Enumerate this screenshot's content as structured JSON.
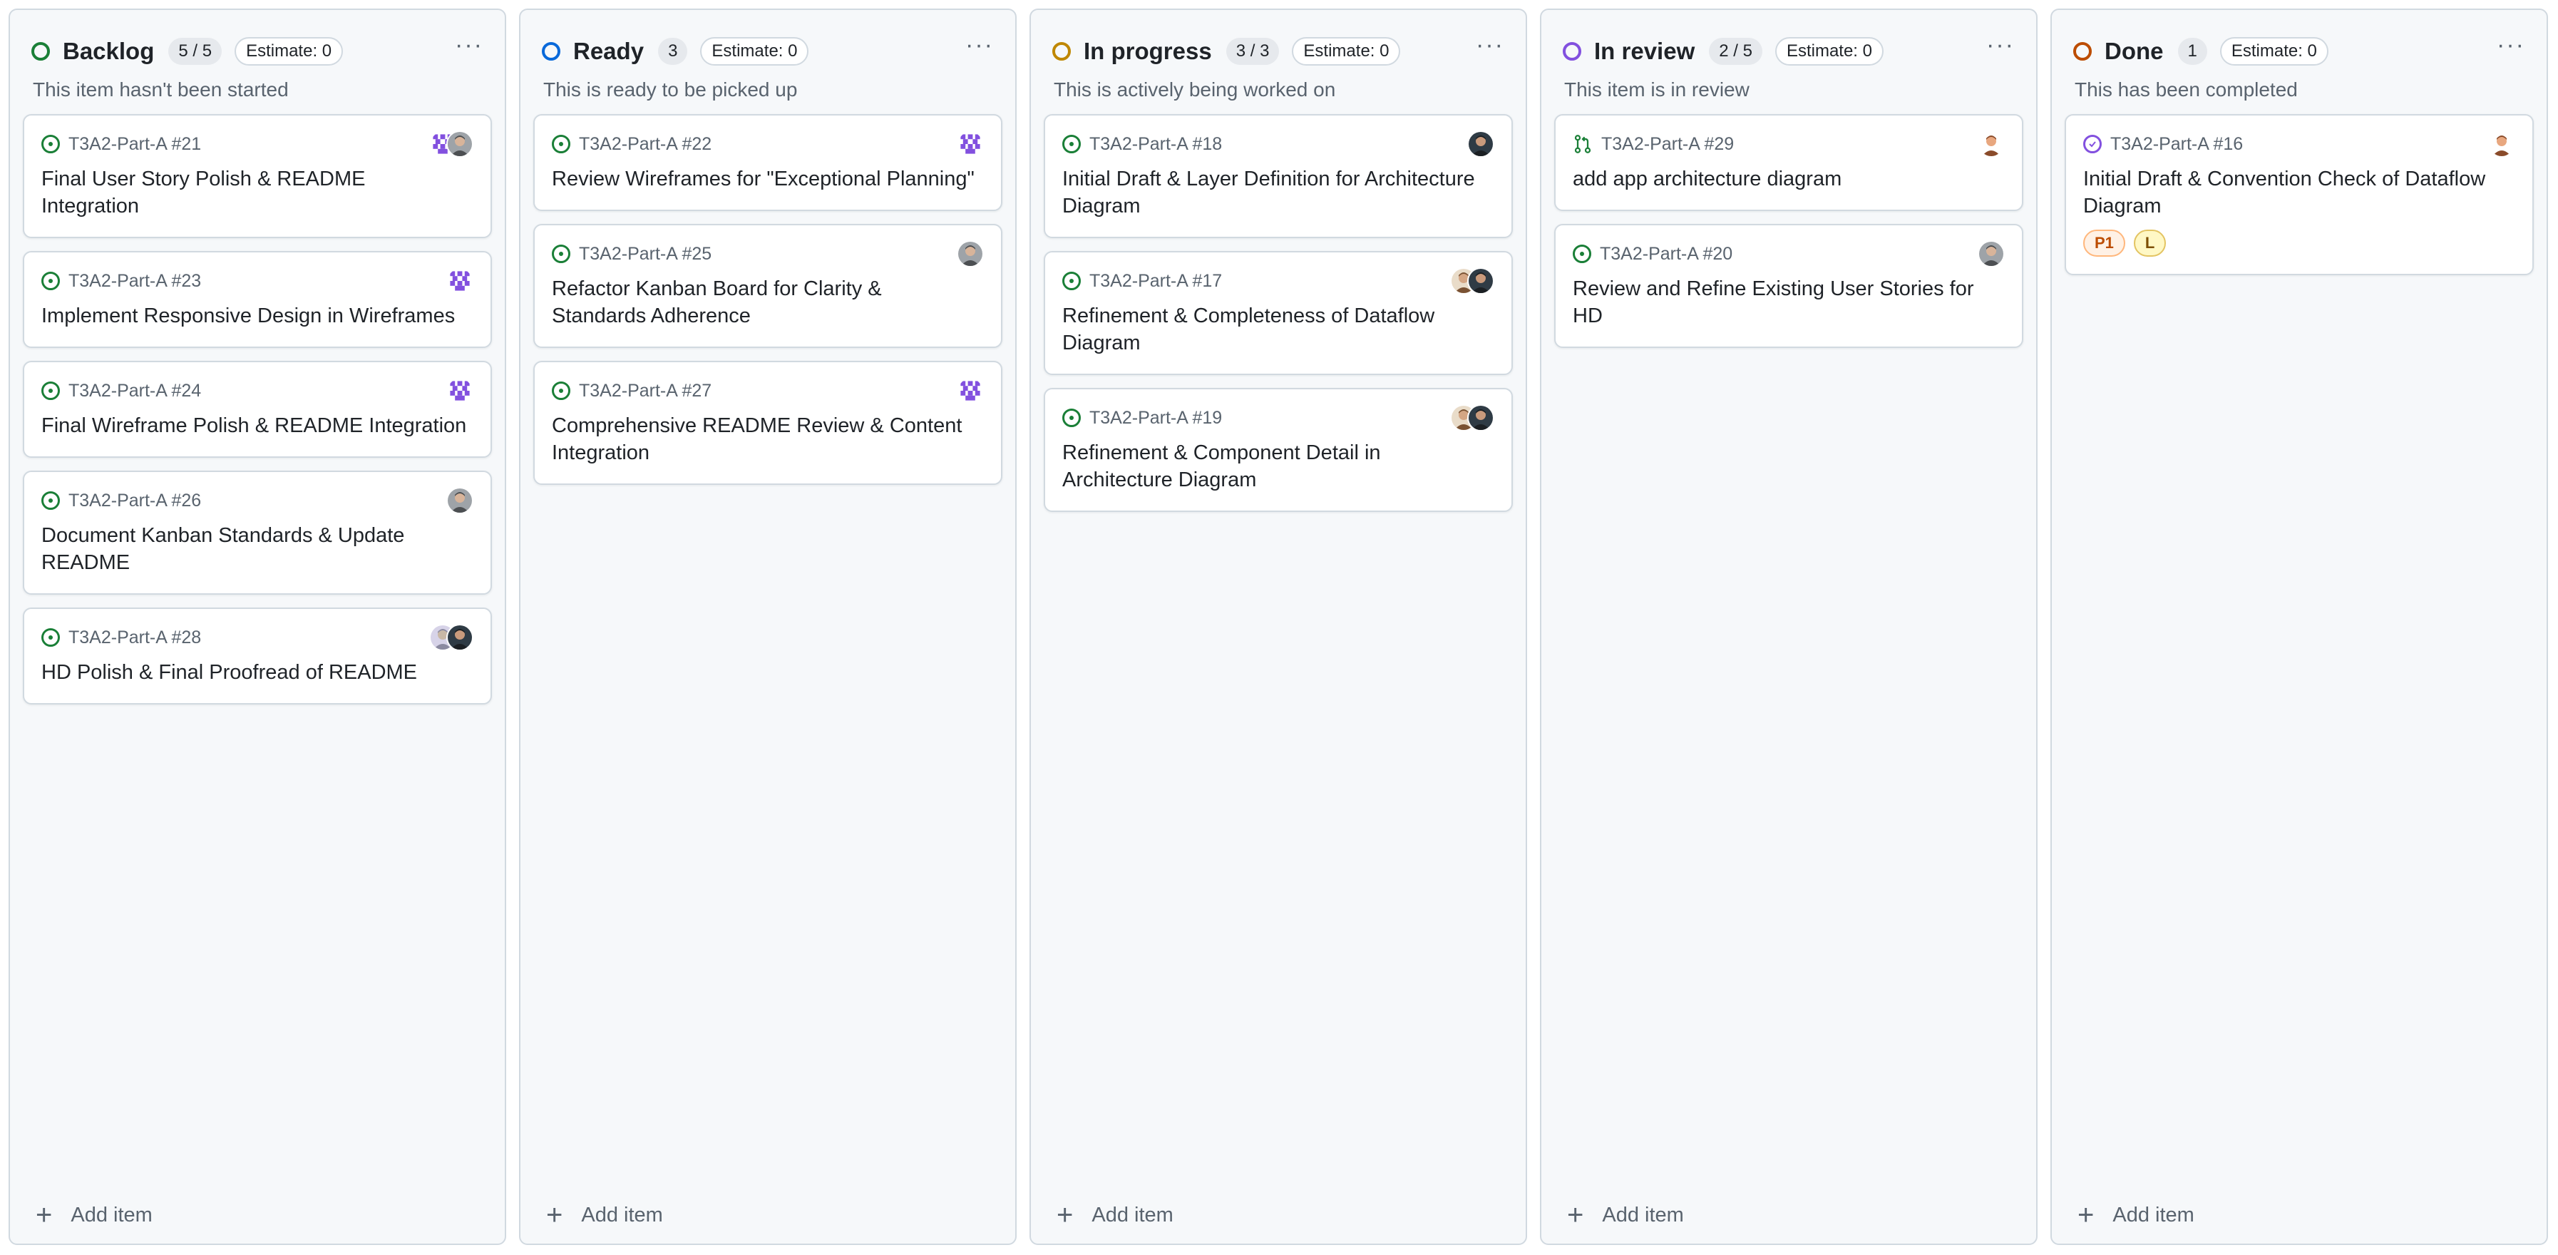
{
  "colors": {
    "backlog": "#1a7f37",
    "ready": "#0969da",
    "in_progress": "#bf8700",
    "in_review": "#8250df",
    "done": "#bc4c00"
  },
  "columns": [
    {
      "id": "backlog",
      "title": "Backlog",
      "count": "5 / 5",
      "estimate": "Estimate: 0",
      "description": "This item hasn't been started",
      "add_label": "Add item",
      "cards": [
        {
          "ref": "T3A2-Part-A #21",
          "title": "Final User Story Polish & README Integration",
          "icon": "issue-open-icon",
          "avatars": [
            "identicon",
            "person-gray"
          ]
        },
        {
          "ref": "T3A2-Part-A #23",
          "title": "Implement Responsive Design in Wireframes",
          "icon": "issue-open-icon",
          "avatars": [
            "identicon"
          ]
        },
        {
          "ref": "T3A2-Part-A #24",
          "title": "Final Wireframe Polish & README Integration",
          "icon": "issue-open-icon",
          "avatars": [
            "identicon"
          ]
        },
        {
          "ref": "T3A2-Part-A #26",
          "title": "Document Kanban Standards & Update README",
          "icon": "issue-open-icon",
          "avatars": [
            "person-gray"
          ]
        },
        {
          "ref": "T3A2-Part-A #28",
          "title": "HD Polish & Final Proofread of README",
          "icon": "issue-open-icon",
          "avatars": [
            "person-faded",
            "person-dark"
          ]
        }
      ]
    },
    {
      "id": "ready",
      "title": "Ready",
      "count": "3",
      "estimate": "Estimate: 0",
      "description": "This is ready to be picked up",
      "add_label": "Add item",
      "cards": [
        {
          "ref": "T3A2-Part-A #22",
          "title": "Review Wireframes for \"Exceptional Planning\"",
          "icon": "issue-open-icon",
          "avatars": [
            "identicon"
          ]
        },
        {
          "ref": "T3A2-Part-A #25",
          "title": "Refactor Kanban Board for Clarity & Standards Adherence",
          "icon": "issue-open-icon",
          "avatars": [
            "person-gray"
          ]
        },
        {
          "ref": "T3A2-Part-A #27",
          "title": "Comprehensive README Review & Content Integration",
          "icon": "issue-open-icon",
          "avatars": [
            "identicon"
          ]
        }
      ]
    },
    {
      "id": "in_progress",
      "title": "In progress",
      "count": "3 / 3",
      "estimate": "Estimate: 0",
      "description": "This is actively being worked on",
      "add_label": "Add item",
      "cards": [
        {
          "ref": "T3A2-Part-A #18",
          "title": "Initial Draft & Layer Definition for Architecture Diagram",
          "icon": "issue-open-icon",
          "avatars": [
            "person-dark"
          ]
        },
        {
          "ref": "T3A2-Part-A #17",
          "title": "Refinement & Completeness of Dataflow Diagram",
          "icon": "issue-open-icon",
          "avatars": [
            "person-light",
            "person-dark"
          ]
        },
        {
          "ref": "T3A2-Part-A #19",
          "title": "Refinement & Component Detail in Architecture Diagram",
          "icon": "issue-open-icon",
          "avatars": [
            "person-light",
            "person-dark"
          ]
        }
      ]
    },
    {
      "id": "in_review",
      "title": "In review",
      "count": "2 / 5",
      "estimate": "Estimate: 0",
      "description": "This item is in review",
      "add_label": "Add item",
      "cards": [
        {
          "ref": "T3A2-Part-A #29",
          "title": "add app architecture diagram",
          "icon": "pull-request-icon",
          "avatars": [
            "person-cartoon"
          ]
        },
        {
          "ref": "T3A2-Part-A #20",
          "title": "Review and Refine Existing User Stories for HD",
          "icon": "issue-open-icon",
          "avatars": [
            "person-gray"
          ]
        }
      ]
    },
    {
      "id": "done",
      "title": "Done",
      "count": "1",
      "estimate": "Estimate: 0",
      "description": "This has been completed",
      "add_label": "Add item",
      "cards": [
        {
          "ref": "T3A2-Part-A #16",
          "title": "Initial Draft & Convention Check of Dataflow Diagram",
          "icon": "issue-closed-icon",
          "avatars": [
            "person-cartoon"
          ],
          "labels": [
            {
              "text": "P1",
              "color": "#bc4c00",
              "bg": "#fff1e5",
              "border": "#ffb77c"
            },
            {
              "text": "L",
              "color": "#7d4e00",
              "bg": "#fff8c5",
              "border": "#e3c462"
            }
          ]
        }
      ]
    }
  ]
}
